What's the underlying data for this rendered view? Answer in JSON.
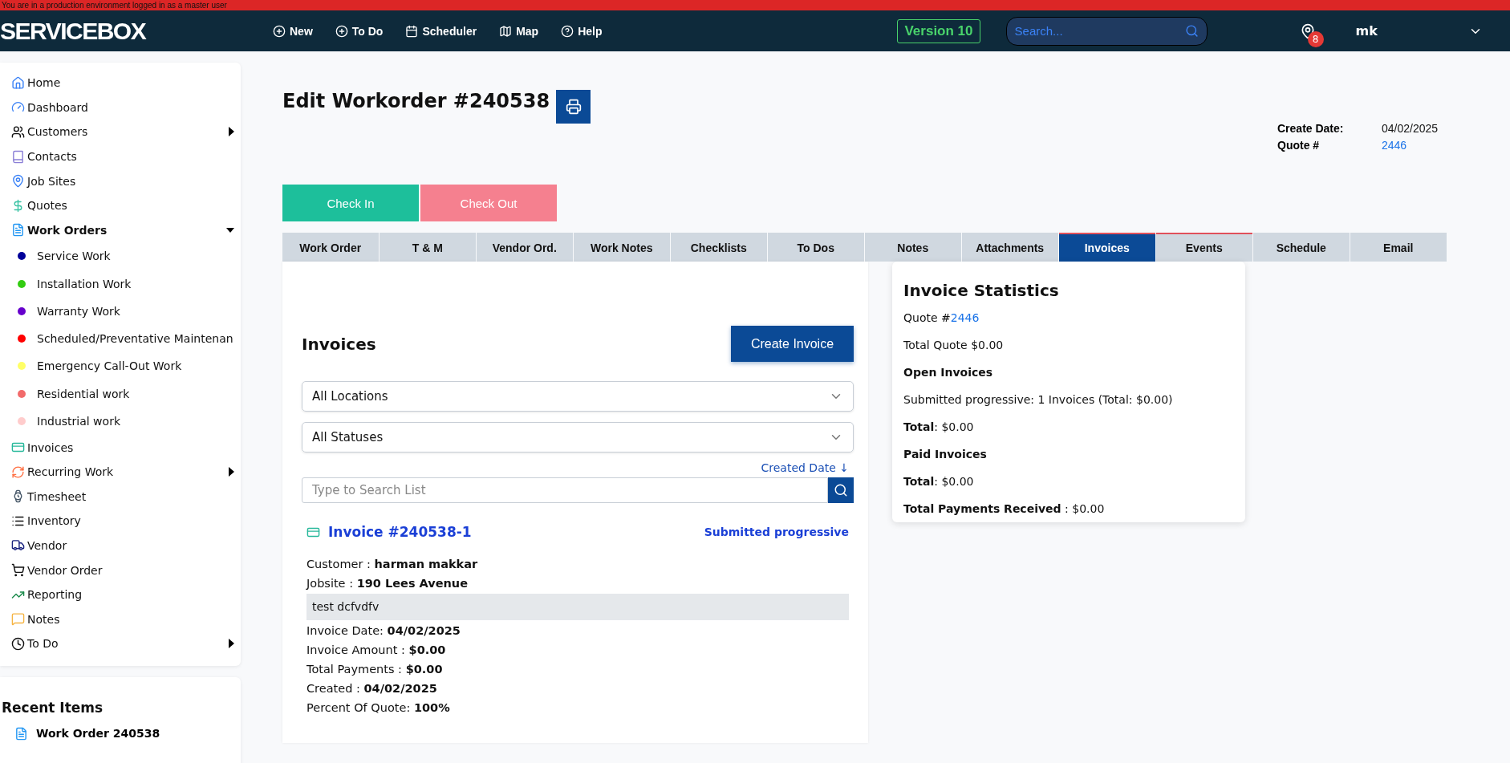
{
  "banner": "You are in a production environment logged in as a master user",
  "topbar": {
    "logo": "SERVICEBOX",
    "nav": [
      "New",
      "To Do",
      "Scheduler",
      "Map",
      "Help"
    ],
    "version": "Version 10",
    "search": {
      "placeholder": "Search..."
    },
    "notification_count": "8",
    "user": "mk"
  },
  "sidebar": {
    "items": [
      {
        "label": "Home"
      },
      {
        "label": "Dashboard"
      },
      {
        "label": "Customers",
        "expanded": false
      },
      {
        "label": "Contacts"
      },
      {
        "label": "Job Sites"
      },
      {
        "label": "Quotes"
      },
      {
        "label": "Work Orders",
        "expanded": true,
        "children": [
          {
            "label": "Service Work",
            "color": "#000099"
          },
          {
            "label": "Installation Work",
            "color": "#33cc11"
          },
          {
            "label": "Warranty Work",
            "color": "#6600cc"
          },
          {
            "label": "Scheduled/Preventative Maintenan",
            "color": "#ff0000"
          },
          {
            "label": "Emergency Call-Out Work",
            "color": "#ffff66"
          },
          {
            "label": "Residential work",
            "color": "#f26b6b"
          },
          {
            "label": "Industrial work",
            "color": "#ffcccc"
          }
        ]
      },
      {
        "label": "Invoices"
      },
      {
        "label": "Recurring Work",
        "expanded": false
      },
      {
        "label": "Timesheet"
      },
      {
        "label": "Inventory"
      },
      {
        "label": "Vendor"
      },
      {
        "label": "Vendor Order"
      },
      {
        "label": "Reporting"
      },
      {
        "label": "Notes"
      },
      {
        "label": "To Do",
        "expanded": false
      }
    ]
  },
  "recent": {
    "title": "Recent Items",
    "items": [
      "Work Order 240538"
    ]
  },
  "page": {
    "title": "Edit Workorder #240538",
    "meta": [
      {
        "label": "Create Date:",
        "value": "04/02/2025",
        "kind": "text"
      },
      {
        "label": "Quote #",
        "value": "2446",
        "kind": "link"
      }
    ]
  },
  "actions": [
    {
      "label": "Check In",
      "kind": "check_in"
    },
    {
      "label": "Check Out",
      "kind": "check_out"
    }
  ],
  "tabs": [
    {
      "label": "Work Order",
      "selected": false,
      "flagged": false
    },
    {
      "label": "T & M",
      "selected": false,
      "flagged": false
    },
    {
      "label": "Vendor Ord.",
      "selected": false,
      "flagged": false
    },
    {
      "label": "Work Notes",
      "selected": false,
      "flagged": false
    },
    {
      "label": "Checklists",
      "selected": false,
      "flagged": false
    },
    {
      "label": "To Dos",
      "selected": false,
      "flagged": false
    },
    {
      "label": "Notes",
      "selected": false,
      "flagged": false
    },
    {
      "label": "Attachments",
      "selected": false,
      "flagged": false
    },
    {
      "label": "Invoices",
      "selected": true,
      "flagged": true
    },
    {
      "label": "Events",
      "selected": false,
      "flagged": true
    },
    {
      "label": "Schedule",
      "selected": false,
      "flagged": false
    },
    {
      "label": "Email",
      "selected": false,
      "flagged": false
    }
  ],
  "invoices": {
    "title": "Invoices",
    "create_button": "Create Invoice",
    "filters": [
      "All Locations",
      "All Statuses"
    ],
    "sort": "Created Date ↓",
    "search": {
      "placeholder": "Type to Search List"
    },
    "items": [
      {
        "title": "Invoice #240538-1",
        "status": "Submitted progressive",
        "fields": [
          {
            "kind": "field",
            "label": "Customer :",
            "value": "harman makkar"
          },
          {
            "kind": "field",
            "label": "Jobsite :",
            "value": "190 Lees Avenue"
          },
          {
            "kind": "note",
            "value": "test dcfvdfv"
          },
          {
            "kind": "field",
            "label": "Invoice Date:",
            "value": "04/02/2025"
          },
          {
            "kind": "field",
            "label": "Invoice Amount :",
            "value": "$0.00"
          },
          {
            "kind": "field",
            "label": "Total Payments :",
            "value": "$0.00"
          },
          {
            "kind": "field",
            "label": "Created :",
            "value": "04/02/2025"
          },
          {
            "kind": "field",
            "label": "Percent Of Quote:",
            "value": "100%"
          }
        ]
      }
    ]
  },
  "stats": {
    "title": "Invoice Statistics",
    "lines": [
      {
        "kind": "link_line",
        "text": "Quote #",
        "link": "2446"
      },
      {
        "kind": "text",
        "text": "Total Quote $0.00"
      },
      {
        "kind": "heading",
        "text": "Open Invoices"
      },
      {
        "kind": "text",
        "text": "Submitted progressive: 1 Invoices (Total: $0.00)"
      },
      {
        "kind": "text",
        "text": "**Total**: $0.00"
      },
      {
        "kind": "heading",
        "text": "Paid Invoices"
      },
      {
        "kind": "text",
        "text": "**Total**: $0.00"
      },
      {
        "kind": "text",
        "text": "**Total Payments Received** : $0.00"
      }
    ]
  }
}
